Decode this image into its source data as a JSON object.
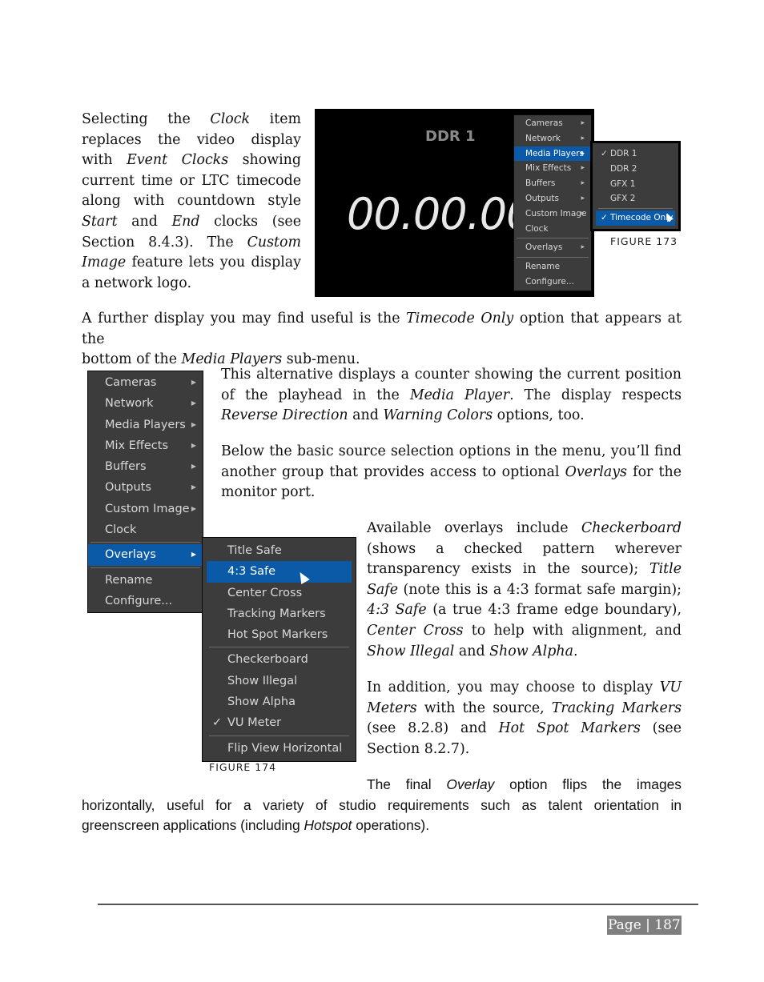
{
  "para1": {
    "lines": [
      [
        "Selecting the ",
        "Clock",
        " item"
      ],
      [
        "replaces the video display"
      ],
      [
        "with ",
        "Event Clocks",
        " showing"
      ],
      [
        "current time or LTC timecode"
      ],
      [
        "along with countdown style"
      ],
      [
        "",
        "Start",
        " and ",
        "End",
        " clocks (see"
      ],
      [
        "Section 8.4.3). The ",
        "Custom"
      ],
      [
        "",
        "Image",
        " feature lets you display"
      ],
      [
        "a network logo."
      ]
    ]
  },
  "figure173": {
    "monitor_label": "DDR 1",
    "timecode": "00.00.00",
    "caption": "FIGURE 173",
    "menu": [
      "Cameras",
      "Network",
      "Media Players",
      "Mix Effects",
      "Buffers",
      "Outputs",
      "Custom Image",
      "Clock",
      "Overlays",
      "Rename",
      "Configure..."
    ],
    "submenu": [
      "DDR 1",
      "DDR 2",
      "GFX 1",
      "GFX 2",
      "Timecode Only"
    ],
    "check": "✓",
    "arrow": "▶"
  },
  "para2": {
    "t1": "A further display you may find useful is the ",
    "i1": "Timecode Only",
    "t2": " option that appears at the",
    "t3": "bottom of the ",
    "i2": "Media Players",
    "t4": " sub-menu."
  },
  "para3": {
    "t1": "This alternative displays a counter showing the current position of the playhead in the ",
    "i1": "Media Player",
    "t2": ".  The display respects ",
    "i2": "Reverse Direction",
    "t3": " and ",
    "i3": "Warning Colors",
    "t4": " options, too."
  },
  "para4": {
    "t1": "Below the basic source selection options in the menu, you’ll find another group that provides access to optional ",
    "i1": "Overlays",
    "t2": " for the monitor port."
  },
  "para5": {
    "t1": "Available overlays include ",
    "i1": "Checkerboard",
    "t2": " (shows a checked pattern wherever transparency exists in the source); ",
    "i2": "Title Safe",
    "t3": " (note this is a 4:3 format safe margin); ",
    "i3": "4:3 Safe",
    "t4": " (a true 4:3 frame edge boundary), ",
    "i4": "Center Cross",
    "t5": " to help with alignment, and ",
    "i5": "Show Illegal",
    "t6": " and ",
    "i6": "Show Alpha",
    "t7": "."
  },
  "para6": {
    "t1": "In addition, you may choose to display ",
    "i1": "VU Meters",
    "t2": " with the source, ",
    "i2": "Tracking Markers",
    "t3": " (see 8.2.8) and ",
    "i3": "Hot Spot Markers",
    "t4": " (see Section 8.2.7)."
  },
  "figure174": {
    "caption": "FIGURE 174",
    "menu": [
      "Cameras",
      "Network",
      "Media Players",
      "Mix Effects",
      "Buffers",
      "Outputs",
      "Custom Image",
      "Clock",
      "Overlays",
      "Rename",
      "Configure..."
    ],
    "submenu": [
      "Title Safe",
      "4:3 Safe",
      "Center Cross",
      "Tracking Markers",
      "Hot Spot Markers",
      "Checkerboard",
      "Show Illegal",
      "Show Alpha",
      "VU Meter",
      "Flip View Horizontal"
    ],
    "check": "✓",
    "arrow": "▶"
  },
  "para7": {
    "t1": "The final ",
    "i1": "Overlay",
    "t2": " option flips the images",
    "t3": "horizontally, useful for a variety of studio requirements such as talent orientation in",
    "t4": "greenscreen applications (including ",
    "i2": "Hotspot",
    "t5": " operations)."
  },
  "footer": {
    "page": "Page | 187"
  }
}
